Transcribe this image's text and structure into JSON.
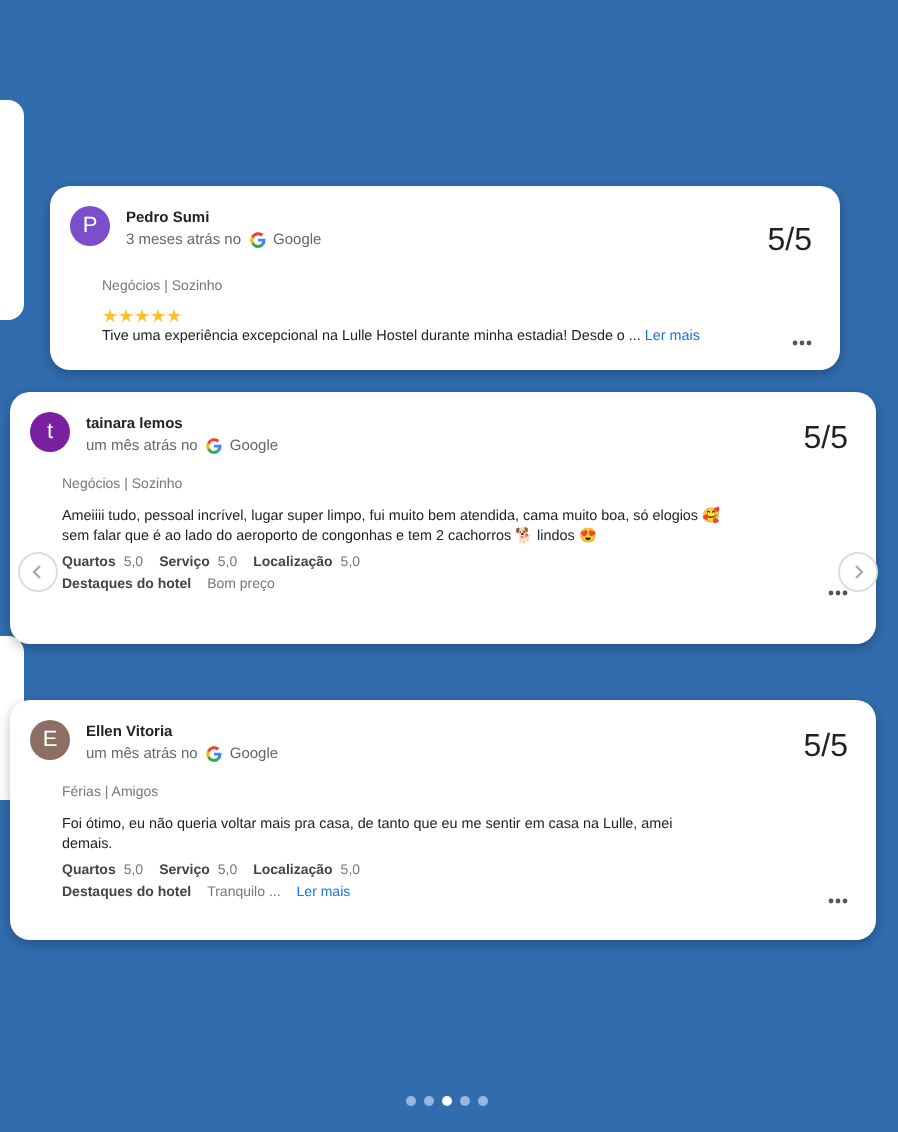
{
  "reviews": [
    {
      "name": "Pedro Sumi",
      "initial": "P",
      "color": "#7b4fc9",
      "time": "3 meses atrás no",
      "source": "Google",
      "score": "5/5",
      "trip": "Negócios | Sozinho",
      "stars": 5,
      "text": "Tive uma experiência excepcional na Lulle Hostel durante minha estadia! Desde o ...",
      "more": "Ler mais"
    },
    {
      "name": "tainara lemos",
      "initial": "t",
      "color": "#7b1fa2",
      "time": "um mês atrás no",
      "source": "Google",
      "score": "5/5",
      "trip": "Negócios | Sozinho",
      "text": "Ameiiii tudo, pessoal incrível, lugar super limpo, fui muito bem atendida, cama muito boa, só elogios 🥰 sem falar que é ao lado do aeroporto de congonhas e tem 2 cachorros 🐕 lindos 😍",
      "ratings": [
        {
          "label": "Quartos",
          "value": "5,0"
        },
        {
          "label": "Serviço",
          "value": "5,0"
        },
        {
          "label": "Localização",
          "value": "5,0"
        }
      ],
      "highlights_label": "Destaques do hotel",
      "highlights": "Bom preço"
    },
    {
      "name": "Ellen Vitoria",
      "initial": "E",
      "color": "#8d6e63",
      "time": "um mês atrás no",
      "source": "Google",
      "score": "5/5",
      "trip": "Férias | Amigos",
      "text": "Foi ótimo, eu não queria voltar mais pra casa, de tanto que eu me sentir em casa na Lulle, amei demais.",
      "ratings": [
        {
          "label": "Quartos",
          "value": "5,0"
        },
        {
          "label": "Serviço",
          "value": "5,0"
        },
        {
          "label": "Localização",
          "value": "5,0"
        }
      ],
      "highlights_label": "Destaques do hotel",
      "highlights": "Tranquilo ...",
      "more": "Ler mais"
    }
  ],
  "dots": [
    {
      "selected": false
    },
    {
      "selected": false
    },
    {
      "selected": true
    },
    {
      "selected": false
    },
    {
      "selected": false
    }
  ]
}
